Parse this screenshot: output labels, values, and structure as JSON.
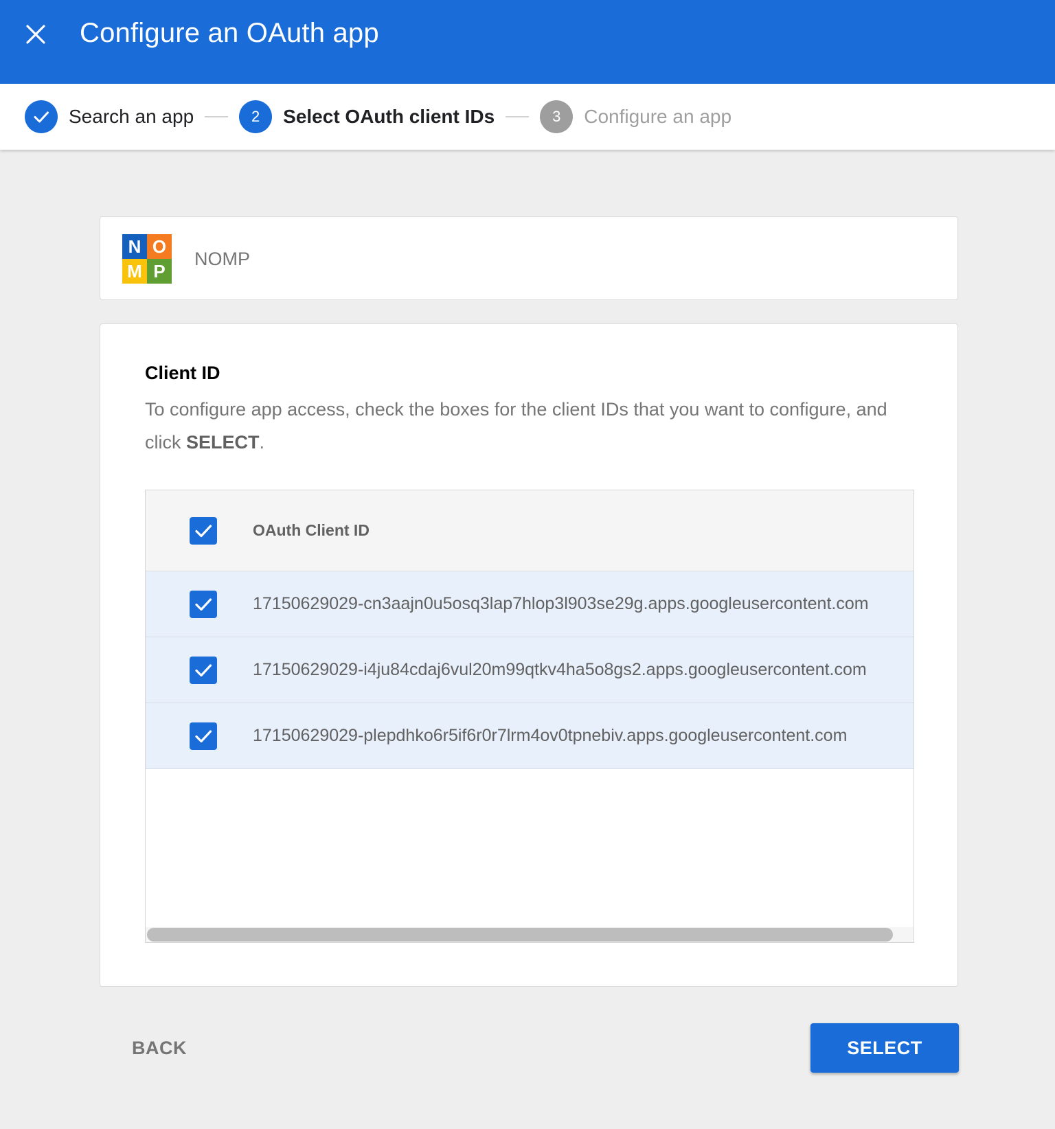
{
  "header": {
    "title": "Configure an OAuth app",
    "close_icon": "close-icon",
    "background_color": "#1a6cd9"
  },
  "stepper": {
    "steps": [
      {
        "label": "Search an app",
        "state": "done",
        "marker": "check-icon"
      },
      {
        "label": "Select OAuth client IDs",
        "state": "active",
        "number": "2"
      },
      {
        "label": "Configure an app",
        "state": "pending",
        "number": "3"
      }
    ]
  },
  "app": {
    "name": "NOMP",
    "logo_letters": [
      "N",
      "O",
      "M",
      "P"
    ],
    "logo_colors": [
      "#1560bd",
      "#f47b20",
      "#f9c20b",
      "#5e9e33"
    ]
  },
  "client_section": {
    "title": "Client ID",
    "description_prefix": "To configure app access, check the boxes for the client IDs that you want to configure, and click ",
    "description_bold": "SELECT",
    "description_suffix": "."
  },
  "table": {
    "header": {
      "label": "OAuth Client ID",
      "checked": true
    },
    "rows": [
      {
        "client_id": "17150629029-cn3aajn0u5osq3lap7hlop3l903se29g.apps.googleusercontent.com",
        "checked": true
      },
      {
        "client_id": "17150629029-i4ju84cdaj6vul20m99qtkv4ha5o8gs2.apps.googleusercontent.com",
        "checked": true
      },
      {
        "client_id": "17150629029-plepdhko6r5if6r0r7lrm4ov0tpnebiv.apps.googleusercontent.com",
        "checked": true
      }
    ]
  },
  "footer": {
    "back_label": "BACK",
    "select_label": "SELECT"
  }
}
